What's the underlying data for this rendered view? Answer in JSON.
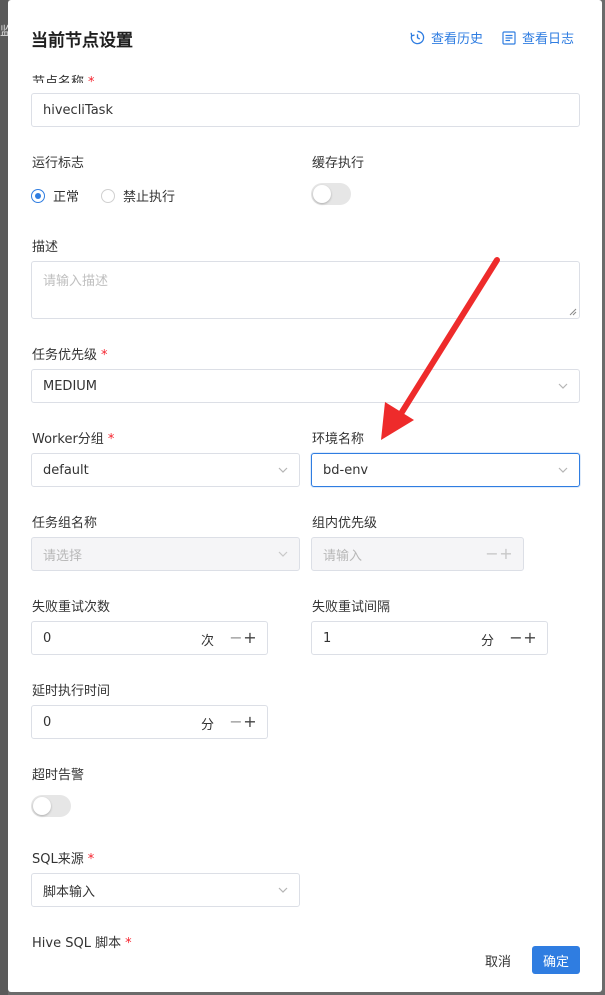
{
  "backdrop": {
    "edge_glyph": "监"
  },
  "header": {
    "title": "当前节点设置",
    "history_link": "查看历史",
    "log_link": "查看日志"
  },
  "form": {
    "node_name": {
      "label": "节点名称",
      "value": "hivecliTask"
    },
    "run_flag": {
      "label": "运行标志",
      "options": [
        "正常",
        "禁止执行"
      ],
      "selected": "正常"
    },
    "cache_execution": {
      "label": "缓存执行",
      "enabled": false
    },
    "description": {
      "label": "描述",
      "placeholder": "请输入描述"
    },
    "task_priority": {
      "label": "任务优先级",
      "value": "MEDIUM"
    },
    "worker_group": {
      "label": "Worker分组",
      "value": "default"
    },
    "environment_name": {
      "label": "环境名称",
      "value": "bd-env"
    },
    "task_group_name": {
      "label": "任务组名称",
      "placeholder": "请选择"
    },
    "group_priority": {
      "label": "组内优先级",
      "placeholder": "请输入"
    },
    "fail_retry_times": {
      "label": "失败重试次数",
      "value": "0",
      "unit": "次"
    },
    "fail_retry_interval": {
      "label": "失败重试间隔",
      "value": "1",
      "unit": "分"
    },
    "delay_execution_time": {
      "label": "延时执行时间",
      "value": "0",
      "unit": "分"
    },
    "timeout_alarm": {
      "label": "超时告警",
      "enabled": false
    },
    "sql_source": {
      "label": "SQL来源",
      "value": "脚本输入"
    },
    "hive_sql_script": {
      "label": "Hive SQL 脚本"
    }
  },
  "footer": {
    "cancel": "取消",
    "confirm": "确定"
  },
  "colors": {
    "accent": "#2f7de1",
    "required": "#f5222d",
    "arrow": "#ee2b2b"
  }
}
